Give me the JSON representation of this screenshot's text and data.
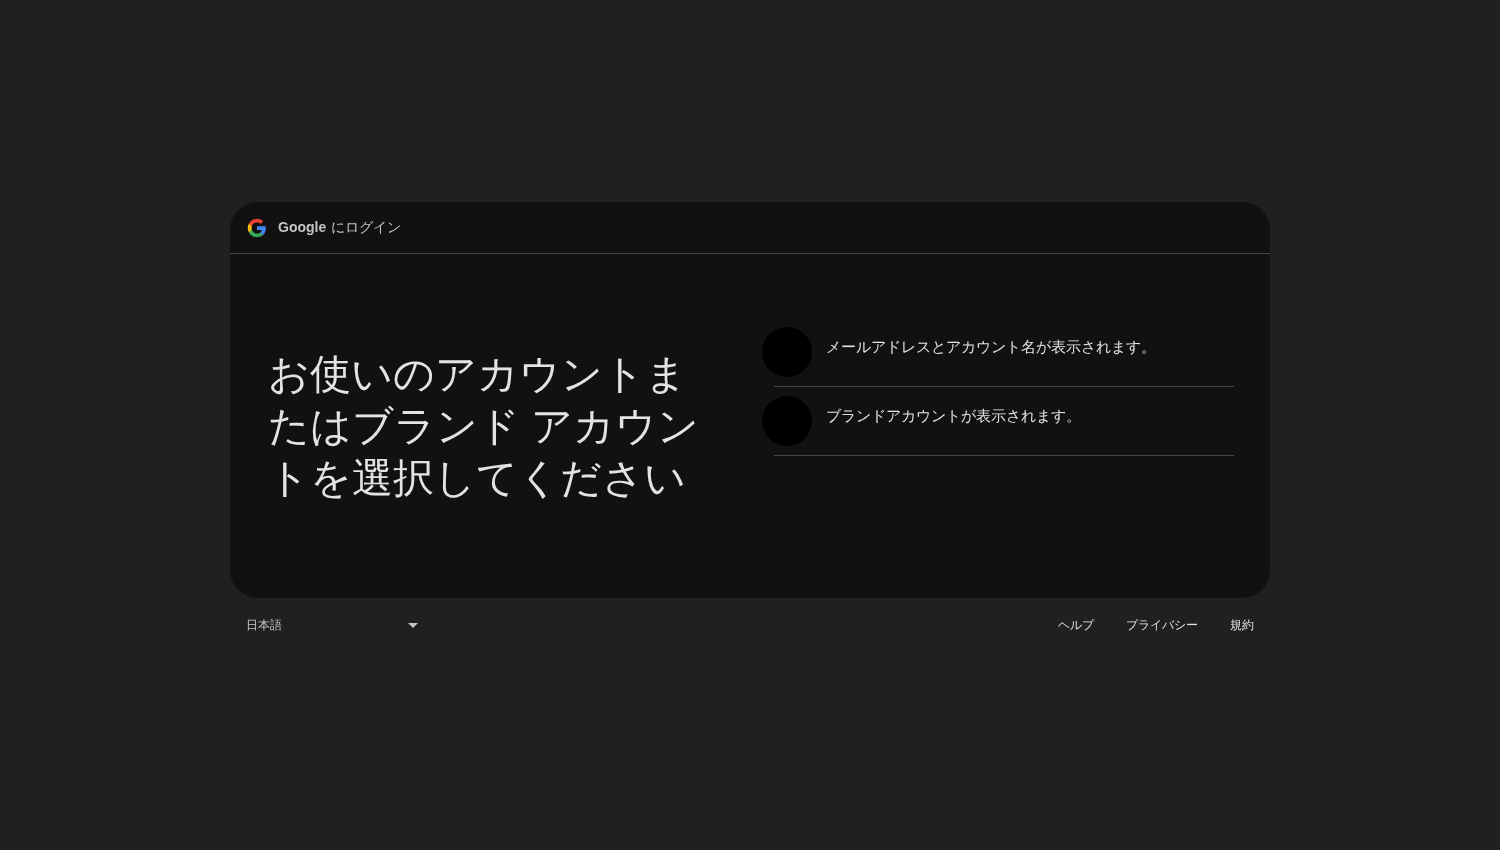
{
  "header": {
    "brand": "Google",
    "title": "にログイン"
  },
  "heading": "お使いのアカウントまたはブランド アカウントを選択してください",
  "accounts": [
    {
      "label": "メールアドレスとアカウント名が表示されます。"
    },
    {
      "label": "ブランドアカウントが表示されます。"
    }
  ],
  "footer": {
    "language": "日本語",
    "links": [
      "ヘルプ",
      "プライバシー",
      "規約"
    ]
  }
}
